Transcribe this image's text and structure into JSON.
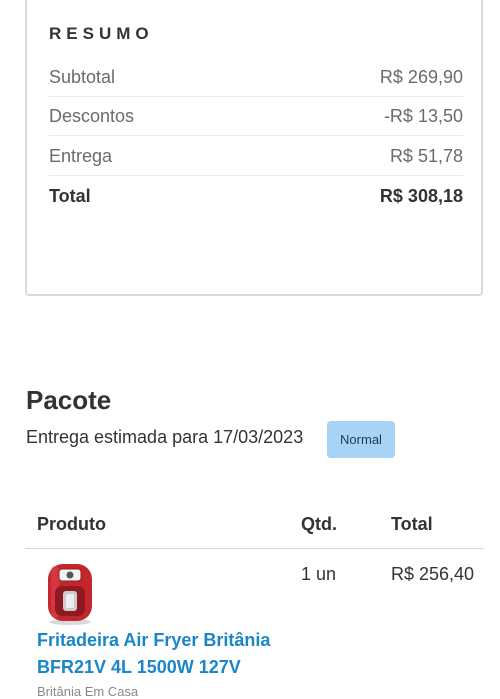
{
  "summary": {
    "heading": "RESUMO",
    "rows": [
      {
        "label": "Subtotal",
        "value": "R$ 269,90"
      },
      {
        "label": "Descontos",
        "value": "-R$ 13,50"
      },
      {
        "label": "Entrega",
        "value": "R$ 51,78"
      },
      {
        "label": "Total",
        "value": "R$ 308,18"
      }
    ]
  },
  "package": {
    "title": "Pacote",
    "delivery_estimate": "Entrega estimada para 17/03/2023",
    "shipping_type": "Normal"
  },
  "table": {
    "headers": {
      "product": "Produto",
      "qty": "Qtd.",
      "total": "Total"
    },
    "items": [
      {
        "image_icon": "air-fryer-image",
        "name": "Fritadeira Air Fryer Britânia BFR21V 4L 1500W 127V",
        "seller": "Britânia Em Casa",
        "qty": "1 un",
        "total": "R$ 256,40"
      }
    ]
  },
  "colors": {
    "link": "#1a86c8",
    "badge_bg": "#a6d3f6",
    "product_red": "#c4262e"
  }
}
